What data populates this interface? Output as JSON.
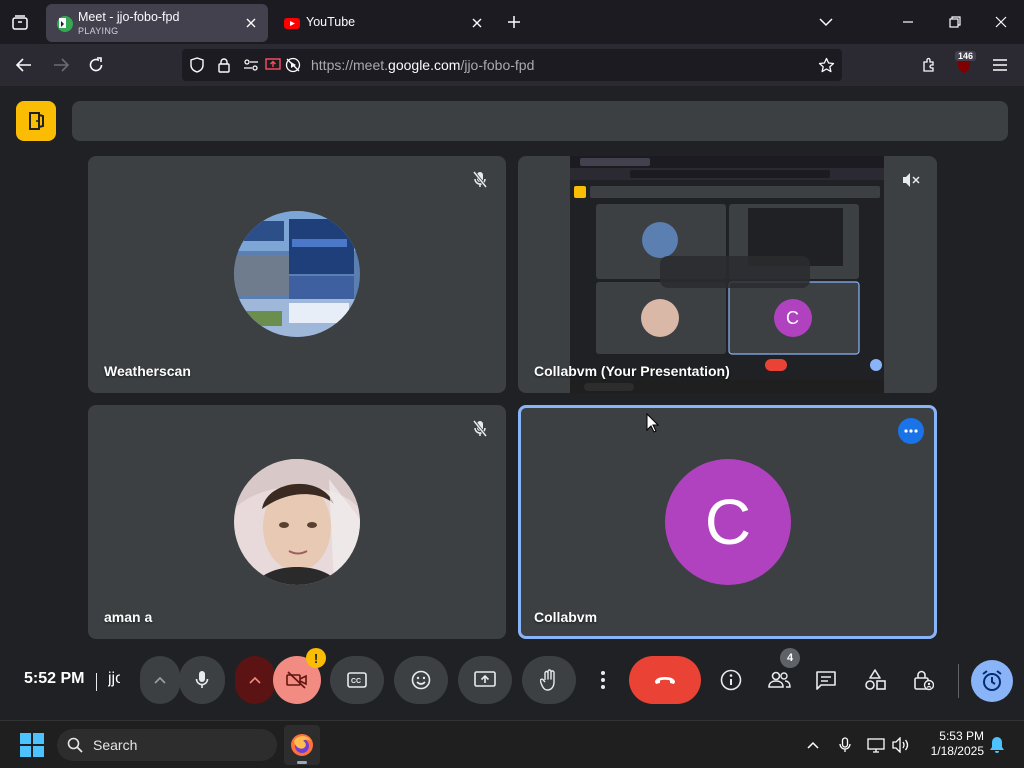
{
  "browser": {
    "tabs": [
      {
        "title": "Meet - jjo-fobo-fpd",
        "subtitle": "PLAYING",
        "active": true
      },
      {
        "title": "YouTube",
        "active": false
      }
    ],
    "url": {
      "prefix": "https://meet.",
      "host": "google.com",
      "path": "/jjo-fobo-fpd"
    },
    "extension_badge": "146"
  },
  "meet": {
    "participants": [
      {
        "name": "Weatherscan",
        "muted": true
      },
      {
        "name": "Collabvm (Your Presentation)",
        "muted": true
      },
      {
        "name": "aman a",
        "muted": true
      },
      {
        "name": "Collabvm",
        "initial": "C",
        "avatar_color": "#b042c0"
      }
    ],
    "preview_initial": "C",
    "bottom_bar": {
      "time": "5:52 PM",
      "meeting_code_fragment": "jjo-fobo-fpd",
      "warning_badge": "!",
      "people_count": "4"
    }
  },
  "taskbar": {
    "search_label": "Search",
    "time": "5:53 PM",
    "date": "1/18/2025"
  },
  "colors": {
    "accent_blue": "#8ab4f8",
    "meet_yellow": "#fbbc04",
    "end_red": "#ea4335",
    "avatar_purple": "#b042c0"
  }
}
